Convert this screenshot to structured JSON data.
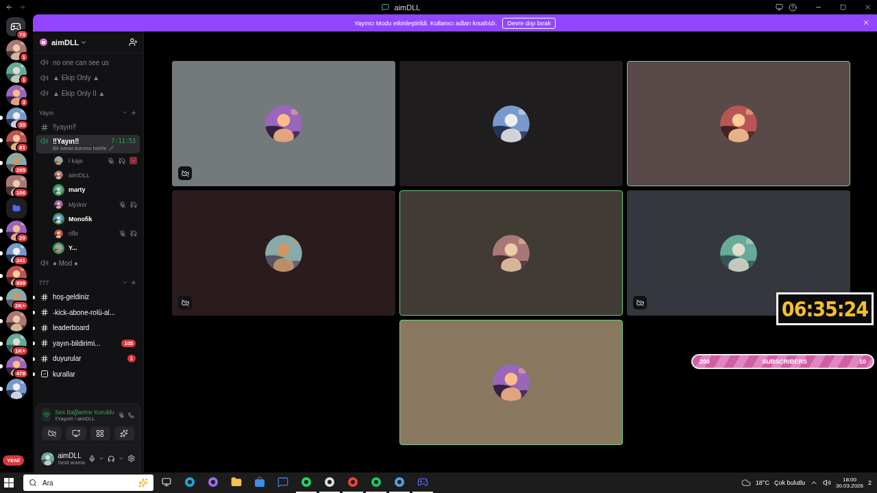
{
  "window": {
    "title": "aimDLL"
  },
  "banner": {
    "text": "Yayıncı Modu etkinleştirildi. Kullanıcı adları kısaltıldı.",
    "button": "Devre dışı bırak"
  },
  "servers": [
    {
      "kind": "home",
      "badge": "78",
      "unread": false
    },
    {
      "kind": "server",
      "badge": "1",
      "unread": false
    },
    {
      "kind": "server",
      "badge": "1",
      "unread": false
    },
    {
      "kind": "server",
      "badge": "3",
      "unread": false
    },
    {
      "kind": "server",
      "badge": "35",
      "unread": true
    },
    {
      "kind": "server",
      "badge": "81",
      "unread": true
    },
    {
      "kind": "server",
      "badge": "295",
      "unread": true
    },
    {
      "kind": "server",
      "badge": "106",
      "unread": false
    },
    {
      "kind": "folder",
      "unread": false
    },
    {
      "kind": "server",
      "badge": "20",
      "unread": true
    },
    {
      "kind": "server",
      "badge": "241",
      "unread": true
    },
    {
      "kind": "server",
      "badge": "939",
      "unread": true
    },
    {
      "kind": "server",
      "badge": "2K+",
      "unread": true
    },
    {
      "kind": "server",
      "unread": true
    },
    {
      "kind": "server",
      "badge": "1K+",
      "unread": true
    },
    {
      "kind": "server",
      "badge": "478",
      "unread": true
    },
    {
      "kind": "server",
      "unread": true
    }
  ],
  "new_badge": "YENİ",
  "sidebar": {
    "server_name": "aimDLL",
    "items": [
      {
        "kind": "voice",
        "name": "no one can see us"
      },
      {
        "kind": "voice",
        "name": "▲ Ekip Only ▲"
      },
      {
        "kind": "voice",
        "name": "▲ Ekip Only II ▲"
      },
      {
        "kind": "category",
        "name": "Yayın"
      },
      {
        "kind": "text",
        "name": "‼yayın‼",
        "unread": false
      },
      {
        "kind": "active_voice",
        "name": "‼Yayın‼",
        "timer": "7:11:53",
        "status": "Bir kanal durumu belirle",
        "members": [
          {
            "name": "l kaje",
            "speaking": false,
            "muted": true,
            "deafened": true,
            "activity": true
          },
          {
            "name": "aimDLL",
            "speaking": false,
            "muted": false,
            "deafened": false,
            "activity": false
          },
          {
            "name": "marty",
            "speaking": true,
            "muted": false,
            "deafened": false,
            "activity": false
          },
          {
            "name": "Mjolnir",
            "speaking": false,
            "muted": true,
            "deafened": true,
            "activity": false
          },
          {
            "name": "Monofik",
            "speaking": true,
            "muted": false,
            "deafened": false,
            "activity": false
          },
          {
            "name": "rifle",
            "speaking": false,
            "muted": true,
            "deafened": true,
            "activity": false
          },
          {
            "name": "Y...",
            "speaking": true,
            "muted": false,
            "deafened": false,
            "activity": false
          }
        ]
      },
      {
        "kind": "voice",
        "name": "● Mod ●"
      },
      {
        "kind": "category",
        "name": "777"
      },
      {
        "kind": "text",
        "name": "hoş-geldiniz",
        "unread": true
      },
      {
        "kind": "text",
        "name": "-kick-abone-rolü-al...",
        "unread": true
      },
      {
        "kind": "text",
        "name": "leaderboard",
        "unread": true
      },
      {
        "kind": "text",
        "name": "yayın-bildirimi...",
        "unread": true,
        "badge": "105"
      },
      {
        "kind": "text",
        "name": "duyurular",
        "unread": true,
        "badge": "1"
      },
      {
        "kind": "rules",
        "name": "kurallar",
        "unread": true
      }
    ]
  },
  "voice_panel": {
    "status": "Ses Bağlantısı Kuruldu",
    "channel": "‼Yayın‼ / aimDLL"
  },
  "user": {
    "name": "aimDLL",
    "activity": "Sesli arama"
  },
  "tiles": [
    {
      "speaking": false,
      "video_off": true
    },
    {
      "speaking": false,
      "video_off": false
    },
    {
      "speaking": true,
      "video_off": false
    },
    {
      "speaking": false,
      "video_off": true
    },
    {
      "speaking": true,
      "video_off": false
    },
    {
      "speaking": false,
      "video_off": true
    },
    {
      "speaking": true,
      "video_off": false
    }
  ],
  "timer_overlay": {
    "time": "06:35:24"
  },
  "subscriber_bar": {
    "start": "200",
    "label": "SUBSCRIBERS",
    "end": "10"
  },
  "taskbar": {
    "search_placeholder": "Ara",
    "temperature": "18°C",
    "weather": "Çok bulutlu",
    "time": "18:00",
    "date": "30.03.2026",
    "notifications": "2",
    "apps": [
      {
        "kind": "taskview",
        "active": false
      },
      {
        "kind": "edge",
        "active": false
      },
      {
        "kind": "copilot",
        "active": false
      },
      {
        "kind": "files",
        "active": false
      },
      {
        "kind": "store",
        "active": false
      },
      {
        "kind": "mail",
        "active": false
      },
      {
        "kind": "spotify",
        "active": true
      },
      {
        "kind": "obs",
        "active": true
      },
      {
        "kind": "chrome",
        "active": true
      },
      {
        "kind": "arrow",
        "active": true
      },
      {
        "kind": "steam",
        "active": true
      },
      {
        "kind": "discord",
        "active": true
      }
    ]
  }
}
